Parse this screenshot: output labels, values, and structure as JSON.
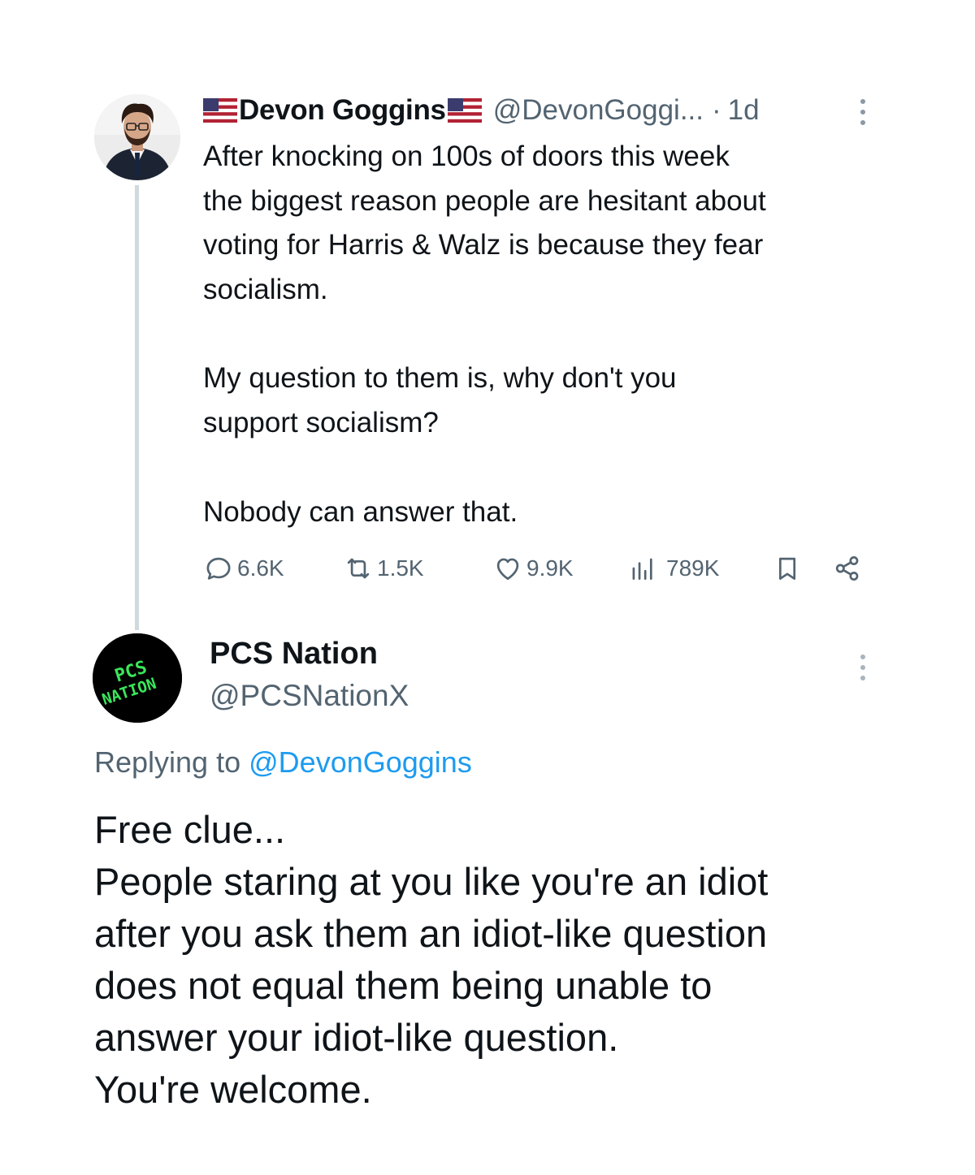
{
  "original_tweet": {
    "author_name": "Devon Goggins",
    "name_emoji": "us-flag-emoji",
    "handle": "@DevonGoggi...",
    "separator": "·",
    "time": "1d",
    "paragraphs": [
      [
        "After knocking on 100s of doors this week",
        "the biggest reason people are hesitant about",
        "voting for Harris & Walz is because they fear",
        "socialism."
      ],
      [
        "My question to them is, why don't you",
        "support socialism?"
      ],
      [
        "Nobody can answer that."
      ]
    ],
    "stats": {
      "replies": "6.6K",
      "reposts": "1.5K",
      "likes": "9.9K",
      "views": "789K"
    },
    "icons": [
      "reply-icon",
      "repost-icon",
      "like-icon",
      "views-icon",
      "bookmark-icon",
      "share-icon",
      "more-options-icon"
    ]
  },
  "reply_tweet": {
    "author_name": "PCS Nation",
    "handle": "@PCSNationX",
    "avatar_text": [
      "PCS",
      "NATION"
    ],
    "replying_prefix": "Replying to",
    "replying_to": "@DevonGoggins",
    "lines": [
      "Free clue...",
      "People staring at you like you're an idiot",
      "after you ask them an idiot-like question",
      "does not equal them being unable to",
      "answer your idiot-like question.",
      "You're welcome."
    ]
  },
  "colors": {
    "text": "#0f1419",
    "secondary": "#536471",
    "link": "#1d9bf0",
    "thread_line": "#cfd9de",
    "avatar_logo_green": "#39e65a"
  }
}
